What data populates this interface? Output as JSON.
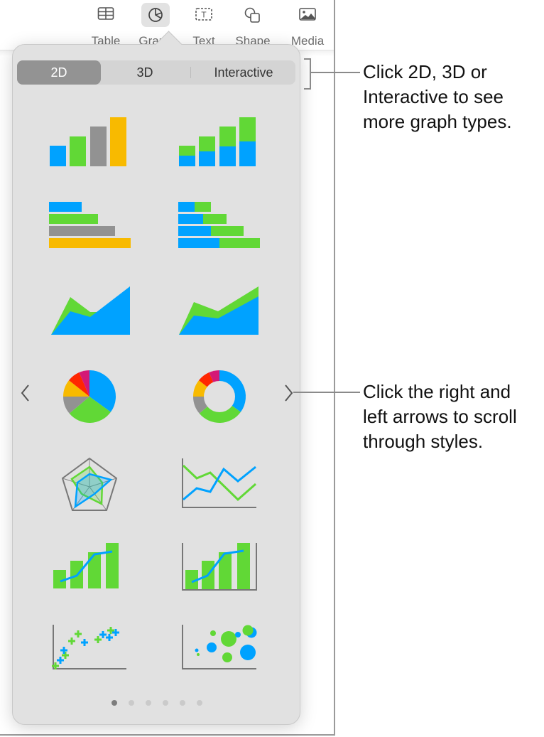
{
  "toolbar": {
    "items": [
      {
        "label": "Table",
        "icon": "table-icon"
      },
      {
        "label": "Graph",
        "icon": "pie-chart-icon",
        "active": true
      },
      {
        "label": "Text",
        "icon": "text-box-icon"
      },
      {
        "label": "Shape",
        "icon": "shape-icon"
      },
      {
        "label": "Media",
        "icon": "photo-icon"
      }
    ]
  },
  "popover": {
    "segments": [
      {
        "label": "2D",
        "selected": true
      },
      {
        "label": "3D",
        "selected": false
      },
      {
        "label": "Interactive",
        "selected": false
      }
    ],
    "chart_types": [
      "2D Column",
      "2D Stacked Column",
      "2D Bar",
      "2D Stacked Bar",
      "2D Area",
      "2D Stacked Area",
      "2D Pie",
      "2D Donut",
      "Radar",
      "2D Line",
      "2D Mixed",
      "2D Two Axis",
      "Scatter",
      "Bubble"
    ],
    "nav": {
      "left": "chevron-left-icon",
      "right": "chevron-right-icon"
    },
    "pages": {
      "count": 6,
      "current": 1
    }
  },
  "colors": {
    "blue": "#00a2ff",
    "green": "#61d836",
    "gray": "#929292",
    "yellow": "#f8ba00",
    "red": "#ff2600",
    "magenta": "#d41876"
  },
  "callouts": [
    {
      "text_lines": [
        "Click 2D, 3D or",
        "Interactive to see",
        "more graph types."
      ]
    },
    {
      "text_lines": [
        "Click the right and",
        "left arrows to scroll",
        "through styles."
      ]
    }
  ]
}
